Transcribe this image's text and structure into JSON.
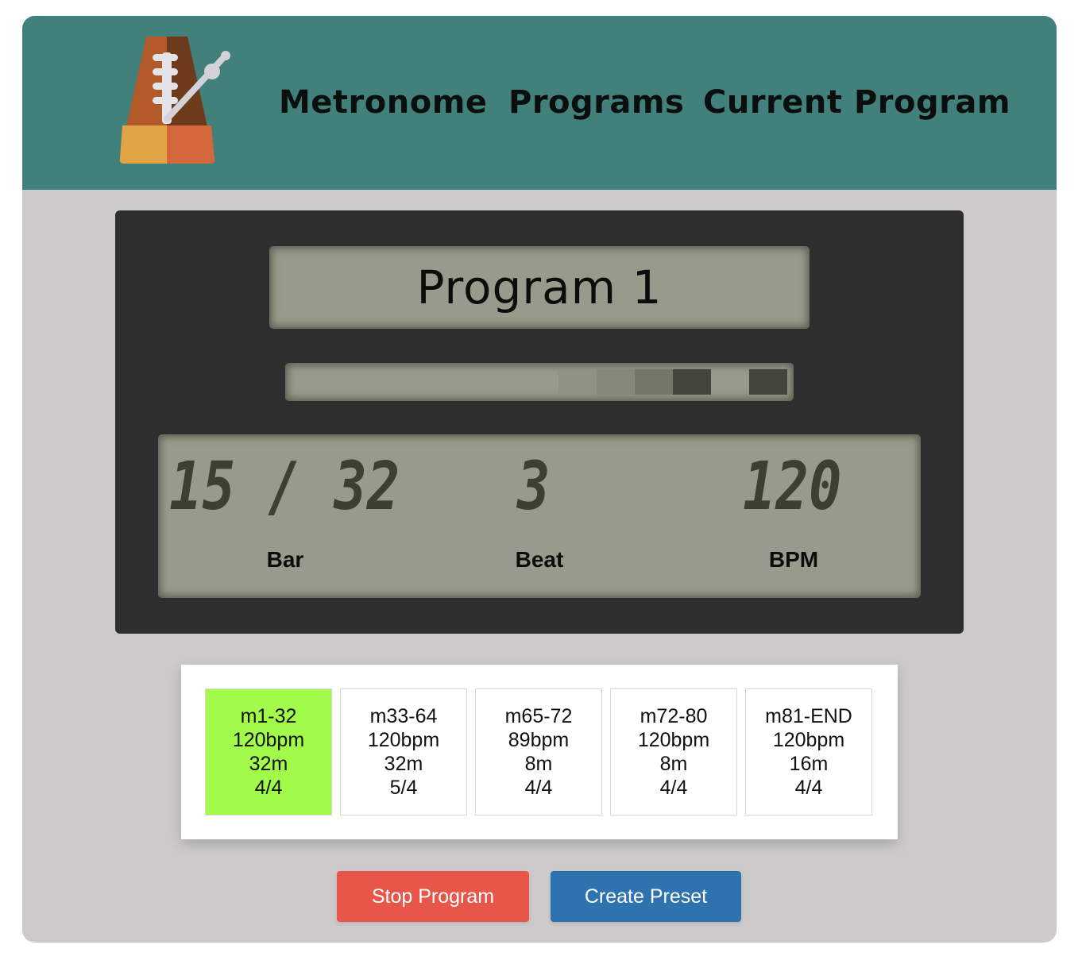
{
  "nav": {
    "metronome": "Metronome",
    "programs": "Programs",
    "current_program": "Current Program"
  },
  "display": {
    "program_name": "Program 1",
    "bar": "15 / 32",
    "beat": "3",
    "bpm": "120",
    "bar_label": "Bar",
    "beat_label": "Beat",
    "bpm_label": "BPM"
  },
  "beat_indicator": {
    "cells": [
      {
        "color": "#8f9182"
      },
      {
        "color": "#868878"
      },
      {
        "color": "#747667"
      },
      {
        "color": "#43463a"
      },
      {
        "color": "#43463a"
      }
    ]
  },
  "sections": [
    {
      "range": "m1-32",
      "tempo": "120bpm",
      "length": "32m",
      "meter": "4/4",
      "active": true
    },
    {
      "range": "m33-64",
      "tempo": "120bpm",
      "length": "32m",
      "meter": "5/4",
      "active": false
    },
    {
      "range": "m65-72",
      "tempo": "89bpm",
      "length": "8m",
      "meter": "4/4",
      "active": false
    },
    {
      "range": "m72-80",
      "tempo": "120bpm",
      "length": "8m",
      "meter": "4/4",
      "active": false
    },
    {
      "range": "m81-END",
      "tempo": "120bpm",
      "length": "16m",
      "meter": "4/4",
      "active": false
    }
  ],
  "buttons": {
    "stop": "Stop Program",
    "create_preset": "Create Preset"
  },
  "colors": {
    "header": "#41807b",
    "background": "#cccaca",
    "active_section": "#a2fa4b",
    "stop_button": "#e8564a",
    "preset_button": "#2f72b0"
  }
}
